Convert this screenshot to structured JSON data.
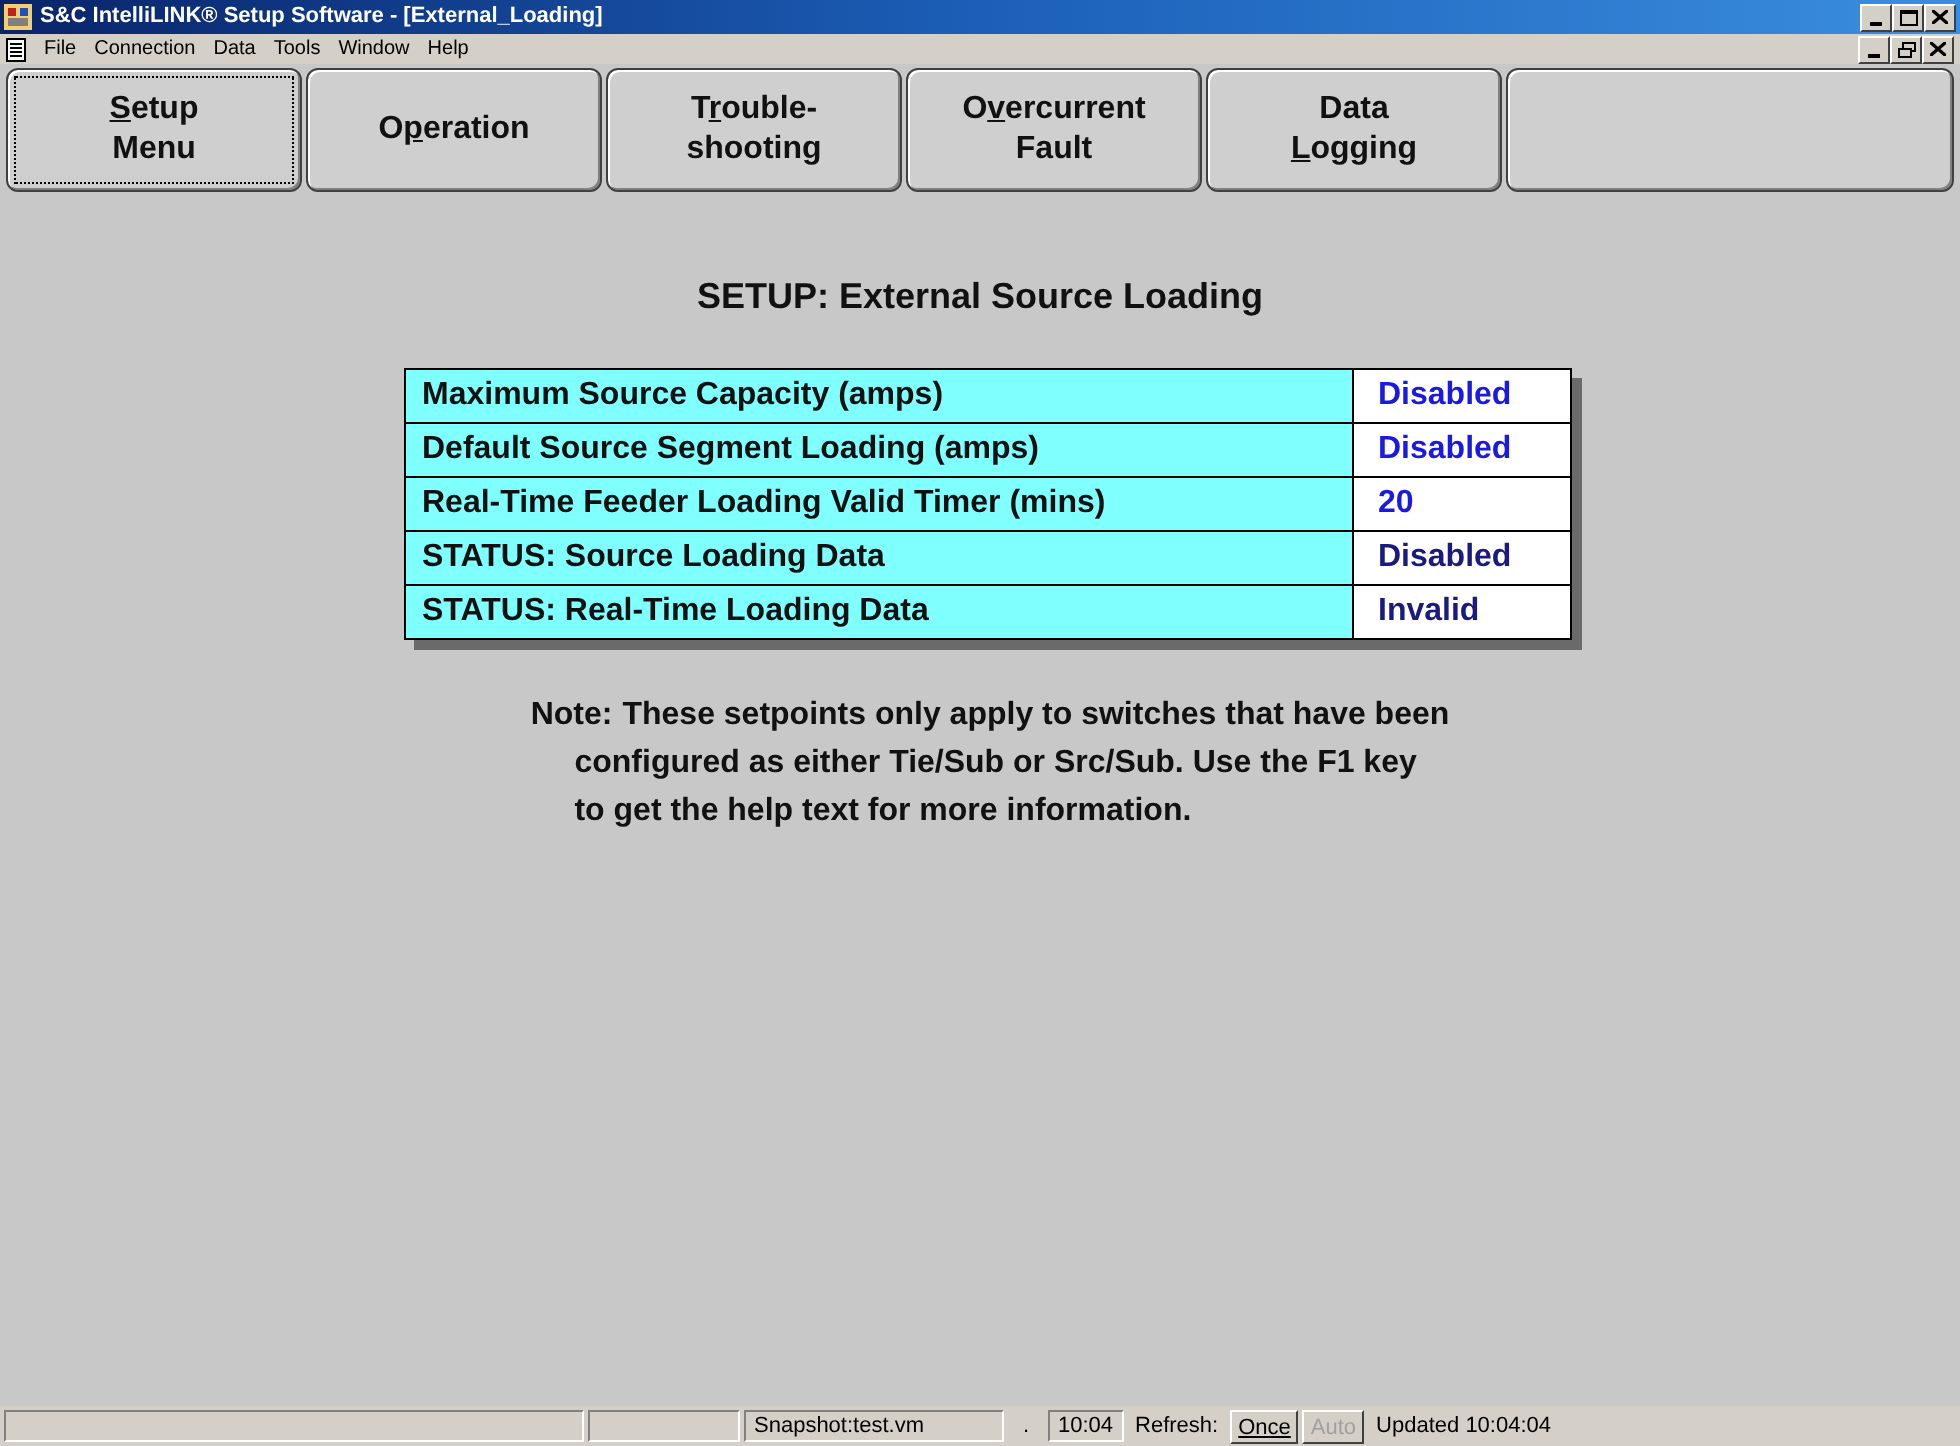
{
  "window": {
    "title": "S&C IntelliLINK® Setup Software - [External_Loading]"
  },
  "menu": [
    "File",
    "Connection",
    "Data",
    "Tools",
    "Window",
    "Help"
  ],
  "nav_buttons": [
    {
      "lines": [
        [
          {
            "text": "S",
            "underline": true
          },
          {
            "text": "etup",
            "underline": false
          }
        ],
        [
          {
            "text": "Menu",
            "underline": false
          }
        ]
      ],
      "selected": true
    },
    {
      "lines": [
        [
          {
            "text": "O",
            "underline": false
          },
          {
            "text": "p",
            "underline": true
          },
          {
            "text": "eration",
            "underline": false
          }
        ]
      ],
      "selected": false
    },
    {
      "lines": [
        [
          {
            "text": "T",
            "underline": false
          },
          {
            "text": "r",
            "underline": true
          },
          {
            "text": "ouble-",
            "underline": false
          }
        ],
        [
          {
            "text": "shooting",
            "underline": false
          }
        ]
      ],
      "selected": false
    },
    {
      "lines": [
        [
          {
            "text": "O",
            "underline": false
          },
          {
            "text": "v",
            "underline": true
          },
          {
            "text": "ercurrent",
            "underline": false
          }
        ],
        [
          {
            "text": "Fault",
            "underline": false
          }
        ]
      ],
      "selected": false
    },
    {
      "lines": [
        [
          {
            "text": "Data",
            "underline": false
          }
        ],
        [
          {
            "text": "L",
            "underline": true
          },
          {
            "text": "ogging",
            "underline": false
          }
        ]
      ],
      "selected": false
    },
    {
      "selected": false
    }
  ],
  "page_title": "SETUP: External Source Loading",
  "settings": [
    {
      "label": "Maximum Source Capacity (amps)",
      "value": "Disabled",
      "kind": "setting"
    },
    {
      "label": "Default Source Segment Loading (amps)",
      "value": "Disabled",
      "kind": "setting"
    },
    {
      "label": "Real-Time Feeder Loading Valid Timer (mins)",
      "value": "20",
      "kind": "setting"
    },
    {
      "label": "STATUS: Source Loading Data",
      "value": "Disabled",
      "kind": "status"
    },
    {
      "label": "STATUS: Real-Time Loading Data",
      "value": "Invalid",
      "kind": "status"
    }
  ],
  "note": {
    "prefix": "Note:",
    "lines": [
      "These setpoints only apply to switches that have been",
      "configured as either Tie/Sub or Src/Sub. Use the F1 key",
      "to get the help text for more information."
    ]
  },
  "status_bar": {
    "file": "Snapshot:test.vm",
    "dot": ".",
    "time": "10:04",
    "refresh_label": "Refresh:",
    "buttons": [
      {
        "label": "Once",
        "disabled": false
      },
      {
        "label": "Auto",
        "disabled": true
      }
    ],
    "updated": "Updated 10:04:04"
  }
}
